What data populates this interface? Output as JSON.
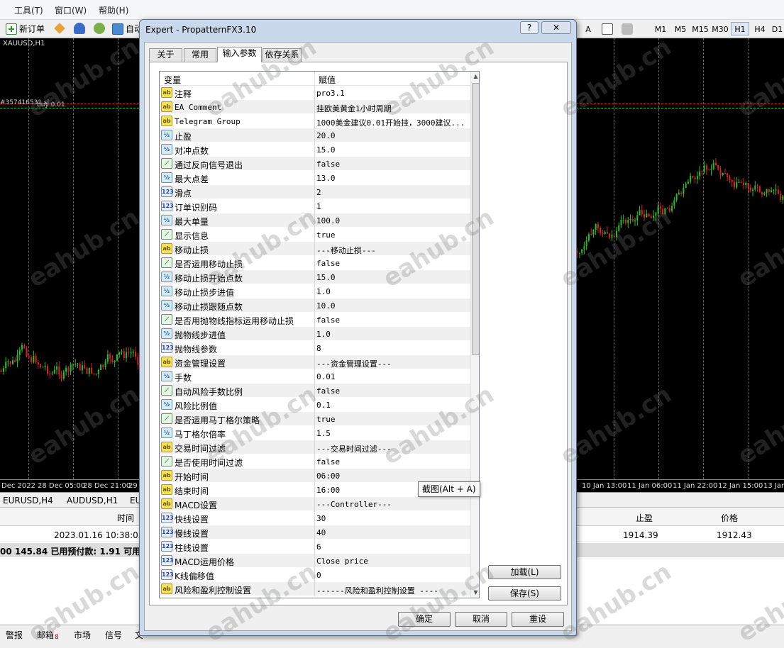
{
  "menu": [
    "工具(T)",
    "窗口(W)",
    "帮助(H)"
  ],
  "toolbar": {
    "new_order": "新订单",
    "auto_trade": "自动",
    "timeframes": [
      "A",
      "M1",
      "M5",
      "M15",
      "M30",
      "H1",
      "H4",
      "D1"
    ],
    "active_timeframe": "H1"
  },
  "chart": {
    "title": "XAUUSD,H1",
    "price_label": "#357416531 sl",
    "order_label": "buy 0.01",
    "left_axis": [
      "Dec 2022",
      "28 Dec 05:00",
      "28 Dec 21:00",
      "29"
    ],
    "right_axis": [
      "10 Jan 13:00",
      "11 Jan 06:00",
      "11 Jan 22:00",
      "12 Jan 15:00",
      "13 Jan"
    ]
  },
  "chart_tabs": [
    "EURUSD,H4",
    "AUDUSD,H1",
    "EU"
  ],
  "terminal": {
    "col_time": "时间",
    "col_tp": "止盈",
    "col_price": "价格",
    "time_value": "2023.01.16 10:38:03",
    "tp_value": "1914.39",
    "price_value": "1912.43",
    "balance_line": "00 145.84  已用预付款: 1.91  可用预"
  },
  "bottom_tabs": [
    "警报",
    "邮箱",
    "市场",
    "信号",
    "文"
  ],
  "mail_badge": "8",
  "watermark": "eahub.cn",
  "dialog": {
    "title": "Expert - PropatternFX3.10",
    "help_btn": "?",
    "close_btn": "✕",
    "tabs": [
      "关于",
      "常用",
      "输入参数",
      "依存关系"
    ],
    "active_tab": "输入参数",
    "col_variable": "变量",
    "col_value": "赋值",
    "rows": [
      {
        "icon": "ab",
        "name": "注释",
        "value": "pro3.1"
      },
      {
        "icon": "ab",
        "name": "EA Comment",
        "value": "挂欧美黄金1小时周期",
        "mono": true
      },
      {
        "icon": "ab",
        "name": "Telegram Group",
        "value": "1000美金建议0.01开始挂，3000建议...",
        "mono": true
      },
      {
        "icon": "num",
        "name": "止盈",
        "value": "20.0"
      },
      {
        "icon": "num",
        "name": "对冲点数",
        "value": "15.0"
      },
      {
        "icon": "bool",
        "name": "通过反向信号退出",
        "value": "false"
      },
      {
        "icon": "num",
        "name": "最大点差",
        "value": "13.0"
      },
      {
        "icon": "int",
        "name": "滑点",
        "value": "2"
      },
      {
        "icon": "int",
        "name": "订单识别码",
        "value": "1"
      },
      {
        "icon": "num",
        "name": "最大单量",
        "value": "100.0"
      },
      {
        "icon": "bool",
        "name": "显示信息",
        "value": "true"
      },
      {
        "icon": "ab",
        "name": "移动止损",
        "value": "---移动止损---"
      },
      {
        "icon": "bool",
        "name": "是否运用移动止损",
        "value": "false"
      },
      {
        "icon": "num",
        "name": "移动止损开始点数",
        "value": "15.0"
      },
      {
        "icon": "num",
        "name": "移动止损步进值",
        "value": "1.0"
      },
      {
        "icon": "num",
        "name": "移动止损跟随点数",
        "value": "10.0"
      },
      {
        "icon": "bool",
        "name": "是否用抛物线指标运用移动止损",
        "value": "false"
      },
      {
        "icon": "num",
        "name": "抛物线步进值",
        "value": "1.0"
      },
      {
        "icon": "int",
        "name": "抛物线参数",
        "value": "8"
      },
      {
        "icon": "ab",
        "name": "资金管理设置",
        "value": "---资金管理设置---"
      },
      {
        "icon": "num",
        "name": "手数",
        "value": "0.01"
      },
      {
        "icon": "bool",
        "name": "自动风险手数比例",
        "value": "false"
      },
      {
        "icon": "num",
        "name": "风险比例值",
        "value": "0.1"
      },
      {
        "icon": "bool",
        "name": "是否运用马丁格尔策略",
        "value": "true"
      },
      {
        "icon": "num",
        "name": "马丁格尔倍率",
        "value": "1.5"
      },
      {
        "icon": "ab",
        "name": "交易时间过滤",
        "value": "---交易时间过滤---"
      },
      {
        "icon": "bool",
        "name": "是否使用时间过滤",
        "value": "false"
      },
      {
        "icon": "ab",
        "name": "开始时间",
        "value": "06:00"
      },
      {
        "icon": "ab",
        "name": "结束时间",
        "value": "16:00"
      },
      {
        "icon": "ab",
        "name": "MACD设置",
        "value": "---Controller---"
      },
      {
        "icon": "int",
        "name": "快线设置",
        "value": "30"
      },
      {
        "icon": "int",
        "name": "慢线设置",
        "value": "40"
      },
      {
        "icon": "int",
        "name": "柱线设置",
        "value": "6"
      },
      {
        "icon": "int",
        "name": "MACD运用价格",
        "value": "Close price"
      },
      {
        "icon": "int",
        "name": "K线偏移值",
        "value": "0"
      },
      {
        "icon": "ab",
        "name": "风险和盈利控制设置",
        "value": "------风险和盈利控制设置 ----"
      }
    ],
    "load_btn": "加载(L)",
    "save_btn": "保存(S)",
    "ok_btn": "确定",
    "cancel_btn": "取消",
    "reset_btn": "重设",
    "tooltip": "截图(Alt + A)"
  }
}
